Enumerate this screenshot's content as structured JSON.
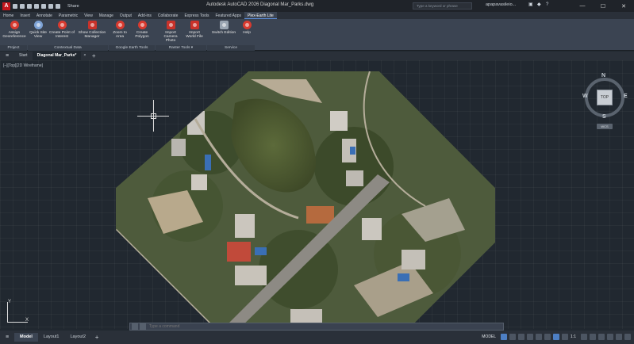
{
  "title_bar": {
    "app_letter": "A",
    "share_label": "Share",
    "window_title": "Autodesk AutoCAD 2026   Diagonal Mar_Parks.dwg",
    "search_placeholder": "Type a keyword or phrase",
    "user_name": "apapavasileio...",
    "minimize": "—",
    "maximize": "☐",
    "close": "✕"
  },
  "ribbon_tabs": [
    "Home",
    "Insert",
    "Annotate",
    "Parametric",
    "View",
    "Manage",
    "Output",
    "Add-ins",
    "Collaborate",
    "Express Tools",
    "Featured Apps",
    "Plex-Earth Lite"
  ],
  "active_ribbon_tab": "Plex-Earth Lite",
  "ribbon_buttons": {
    "assign_georeference": "Assign Georeference",
    "quick_site_view": "Quick Site View",
    "create_poi": "Create Point of Interest",
    "show_collection": "Show Collection Manager",
    "zoom_to_area": "Zoom to Area",
    "create_polygon": "Create Polygon",
    "import_camera_photo": "Import Camera Photo",
    "import_world_file": "Import World File",
    "switch_edition": "Switch Edition",
    "help": "Help"
  },
  "ribbon_groups": {
    "project": "Project",
    "contextual_data": "Contextual Data",
    "google_earth_tools": "Google Earth Tools",
    "raster_tools": "Raster Tools ▾",
    "service": "Service"
  },
  "doc_tabs": {
    "start": "Start",
    "active": "Diagonal Mar_Parks*",
    "close": "×",
    "add": "+"
  },
  "viewport_label": "[–][Top][2D Wireframe]",
  "viewcube": {
    "top": "TOP",
    "north": "N",
    "south": "S",
    "east": "E",
    "west": "W",
    "wcs": "WCS"
  },
  "ucs": {
    "x": "X",
    "y": "Y"
  },
  "command_line": {
    "placeholder": "Type a command"
  },
  "status_bar": {
    "tabs": [
      "Model",
      "Layout1",
      "Layout2"
    ],
    "active_tab": "Model",
    "add": "+",
    "model_label": "MODEL",
    "scale": "1:1"
  },
  "colors": {
    "accent": "#4d7fc4",
    "autocad_red": "#c4161c",
    "canvas_bg": "#212830"
  }
}
